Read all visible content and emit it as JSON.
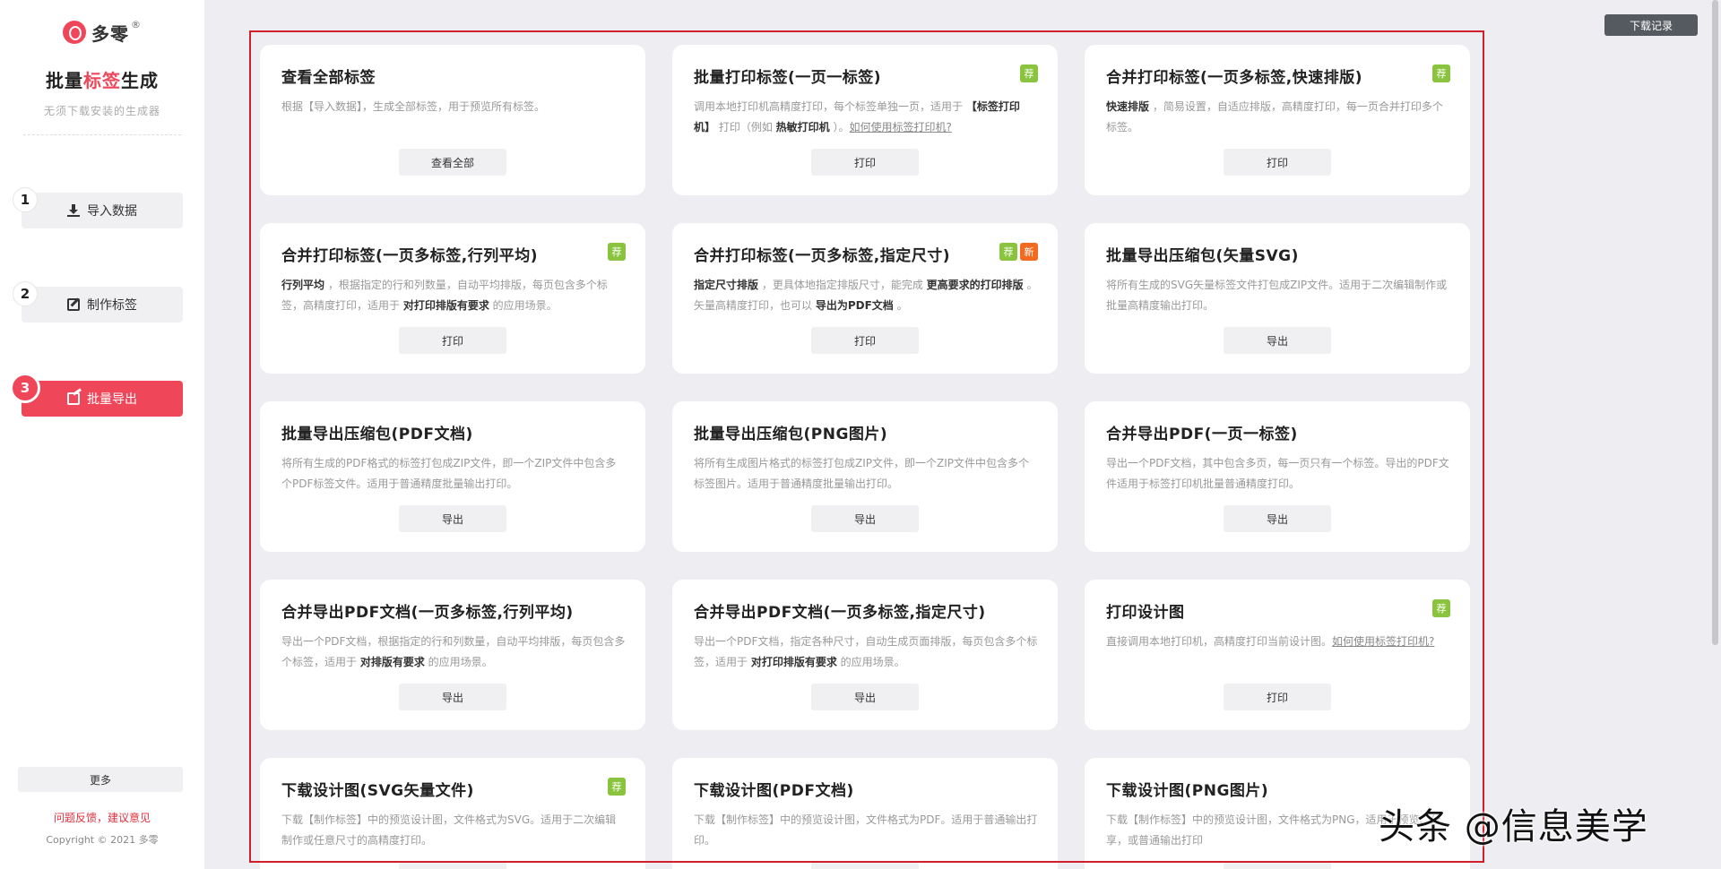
{
  "sidebar": {
    "logo_text": "多零",
    "logo_reg": "®",
    "title_pre": "批量",
    "title_hl": "标签",
    "title_post": "生成",
    "subtitle": "无须下载安装的生成器",
    "steps": [
      {
        "num": "1",
        "label": "导入数据"
      },
      {
        "num": "2",
        "label": "制作标签"
      },
      {
        "num": "3",
        "label": "批量导出"
      }
    ],
    "more_label": "更多",
    "feedback": "问题反馈，建议意见",
    "copyright": "Copyright © 2021 多零"
  },
  "header": {
    "download_record": "下载记录"
  },
  "badge_labels": {
    "rec": "荐",
    "new": "新"
  },
  "cards": [
    {
      "title": "查看全部标签",
      "button": "查看全部",
      "badges": [],
      "desc": [
        {
          "t": "根据【导入数据】，生成全部标签，用于预览所有标签。"
        }
      ]
    },
    {
      "title": "批量打印标签(一页一标签)",
      "button": "打印",
      "badges": [
        "rec"
      ],
      "desc": [
        {
          "t": "调用本地打印机高精度打印，每个标签单独一页，适用于 "
        },
        {
          "t": "【标签打印机】",
          "b": true
        },
        {
          "t": " 打印（例如 "
        },
        {
          "t": "热敏打印机",
          "b": true
        },
        {
          "t": " ）。"
        },
        {
          "t": "如何使用标签打印机?",
          "u": true
        }
      ]
    },
    {
      "title": "合并打印标签(一页多标签,快速排版)",
      "button": "打印",
      "badges": [
        "rec"
      ],
      "desc": [
        {
          "t": "快速排版",
          "b": true
        },
        {
          "t": " ，简易设置，自适应排版，高精度打印，每一页合并打印多个标签。"
        }
      ]
    },
    {
      "title": "合并打印标签(一页多标签,行列平均)",
      "button": "打印",
      "badges": [
        "rec"
      ],
      "desc": [
        {
          "t": "行列平均",
          "b": true
        },
        {
          "t": " ，根据指定的行和列数量，自动平均排版，每页包含多个标签，高精度打印，适用于 "
        },
        {
          "t": "对打印排版有要求",
          "b": true
        },
        {
          "t": " 的应用场景。"
        }
      ]
    },
    {
      "title": "合并打印标签(一页多标签,指定尺寸)",
      "button": "打印",
      "badges": [
        "rec",
        "new"
      ],
      "desc": [
        {
          "t": "指定尺寸排版",
          "b": true
        },
        {
          "t": " ，更具体地指定排版尺寸，能完成 "
        },
        {
          "t": "更高要求的打印排版",
          "b": true
        },
        {
          "t": " 。矢量高精度打印，也可以 "
        },
        {
          "t": "导出为PDF文档",
          "b": true
        },
        {
          "t": " 。"
        }
      ]
    },
    {
      "title": "批量导出压缩包(矢量SVG)",
      "button": "导出",
      "badges": [],
      "desc": [
        {
          "t": "将所有生成的SVG矢量标签文件打包成ZIP文件。适用于二次编辑制作或批量高精度输出打印。"
        }
      ]
    },
    {
      "title": "批量导出压缩包(PDF文档)",
      "button": "导出",
      "badges": [],
      "desc": [
        {
          "t": "将所有生成的PDF格式的标签打包成ZIP文件，即一个ZIP文件中包含多个PDF标签文件。适用于普通精度批量输出打印。"
        }
      ]
    },
    {
      "title": "批量导出压缩包(PNG图片)",
      "button": "导出",
      "badges": [],
      "desc": [
        {
          "t": "将所有生成图片格式的标签打包成ZIP文件，即一个ZIP文件中包含多个标签图片。适用于普通精度批量输出打印。"
        }
      ]
    },
    {
      "title": "合并导出PDF(一页一标签)",
      "button": "导出",
      "badges": [],
      "desc": [
        {
          "t": "导出一个PDF文档，其中包含多页，每一页只有一个标签。导出的PDF文件适用于标签打印机批量普通精度打印。"
        }
      ]
    },
    {
      "title": "合并导出PDF文档(一页多标签,行列平均)",
      "button": "导出",
      "badges": [],
      "desc": [
        {
          "t": "导出一个PDF文档，根据指定的行和列数量，自动平均排版，每页包含多个标签，适用于 "
        },
        {
          "t": "对排版有要求",
          "b": true
        },
        {
          "t": " 的应用场景。"
        }
      ]
    },
    {
      "title": "合并导出PDF文档(一页多标签,指定尺寸)",
      "button": "导出",
      "badges": [],
      "desc": [
        {
          "t": "导出一个PDF文档，指定各种尺寸，自动生成页面排版，每页包含多个标签，适用于 "
        },
        {
          "t": "对打印排版有要求",
          "b": true
        },
        {
          "t": " 的应用场景。"
        }
      ]
    },
    {
      "title": "打印设计图",
      "button": "打印",
      "badges": [
        "rec"
      ],
      "desc": [
        {
          "t": "直接调用本地打印机，高精度打印当前设计图。"
        },
        {
          "t": "如何使用标签打印机?",
          "u": true
        }
      ]
    },
    {
      "title": "下载设计图(SVG矢量文件)",
      "button": "",
      "badges": [
        "rec"
      ],
      "desc": [
        {
          "t": "下载【制作标签】中的预览设计图，文件格式为SVG。适用于二次编辑制作或任意尺寸的高精度打印。"
        }
      ]
    },
    {
      "title": "下载设计图(PDF文档)",
      "button": "",
      "badges": [],
      "desc": [
        {
          "t": "下载【制作标签】中的预览设计图，文件格式为PDF。适用于普通输出打印。"
        }
      ]
    },
    {
      "title": "下载设计图(PNG图片)",
      "button": "",
      "badges": [],
      "desc": [
        {
          "t": "下载【制作标签】中的预览设计图，文件格式为PNG，适用于预览、分享，或普通输出打印"
        }
      ]
    }
  ],
  "watermark": "头条 @信息美学"
}
